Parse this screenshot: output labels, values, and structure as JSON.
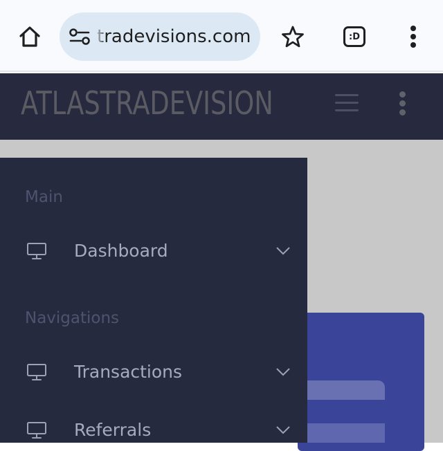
{
  "browser": {
    "url": "tradevisions.com",
    "home_icon": "home-icon",
    "site_settings_icon": "site-settings-icon",
    "bookmark_icon": "star-icon",
    "tab_switcher_label": ":D",
    "menu_icon": "vertical-dots-icon"
  },
  "header": {
    "brand": "ATLASTRADEVISION",
    "menu_toggle_icon": "hamburger-icon",
    "more_icon": "vertical-dots-icon"
  },
  "sidebar": {
    "sections": [
      {
        "title": "Main",
        "items": [
          {
            "label": "Dashboard",
            "icon": "monitor-icon",
            "expand_icon": "chevron-down-icon"
          }
        ]
      },
      {
        "title": "Navigations",
        "items": [
          {
            "label": "Transactions",
            "icon": "monitor-icon",
            "expand_icon": "chevron-down-icon"
          },
          {
            "label": "Referrals",
            "icon": "monitor-icon",
            "expand_icon": "chevron-down-icon"
          }
        ]
      }
    ]
  },
  "colors": {
    "header_bg": "#272a3f",
    "sidebar_bg": "#262a3e",
    "card_blue": "#3a4499",
    "backdrop": "#c8c8c8"
  }
}
